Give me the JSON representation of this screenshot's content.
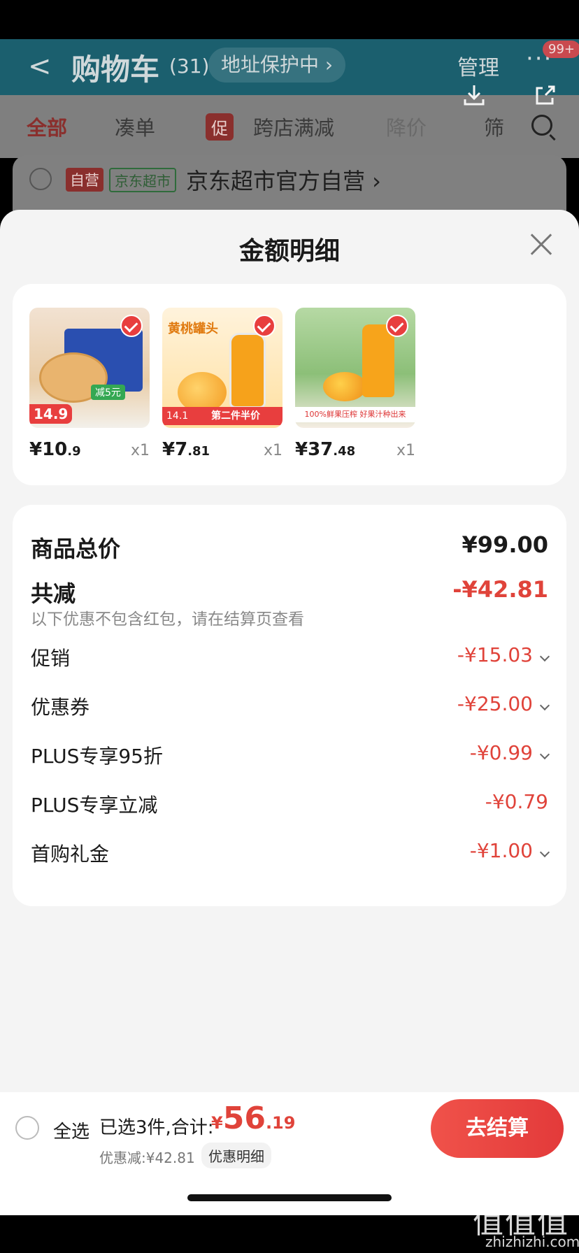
{
  "cart": {
    "back": "<",
    "title": "购物车",
    "count": "(31)",
    "address": "地址保护中 ›",
    "manage": "管理",
    "more": "···",
    "badge": "99+"
  },
  "tabs": {
    "all": "全部",
    "coudan": "凑单",
    "promo_tag": "促",
    "cross_store": "跨店满减",
    "price_down": "降价",
    "filter": "筛"
  },
  "store": {
    "tag_self": "自营",
    "tag_jd": "京东超市",
    "name": "京东超市官方自营 ›"
  },
  "sheet": {
    "title": "金额明细"
  },
  "products": [
    {
      "price_int": "¥10",
      "price_dec": ".9",
      "qty": "x1",
      "tag": "14.9",
      "badge": "减5元"
    },
    {
      "price_int": "¥7",
      "price_dec": ".81",
      "qty": "x1",
      "title": "黄桃罐头",
      "tag": "14.1",
      "tag_text": "第二件半价"
    },
    {
      "price_int": "¥37",
      "price_dec": ".48",
      "qty": "x1",
      "banner": "100%鲜果压榨 好果汁种出来"
    }
  ],
  "summary": {
    "total_label": "商品总价",
    "total_value": "¥99.00",
    "reduce_label": "共减",
    "reduce_value": "-¥42.81",
    "note": "以下优惠不包含红包，请在结算页查看",
    "items": [
      {
        "label": "促销",
        "value": "-¥15.03"
      },
      {
        "label": "优惠券",
        "value": "-¥25.00"
      },
      {
        "label": "PLUS专享95折",
        "value": "-¥0.99"
      },
      {
        "label": "PLUS专享立减",
        "value": "-¥0.79"
      },
      {
        "label": "首购礼金",
        "value": "-¥1.00"
      }
    ]
  },
  "bottom": {
    "select_all": "全选",
    "selected": "已选3件,合计:",
    "total_yen": "¥",
    "total_int": "56",
    "total_dec": ".19",
    "discount": "优惠减:¥42.81",
    "detail": "优惠明细",
    "checkout": "去结算"
  },
  "watermark": {
    "mark": "值值值",
    "url": "zhizhizhi.com"
  },
  "colors": {
    "accent": "#e0433a",
    "checkout": "#e83e3e",
    "header_dim": "#1b5f6e"
  }
}
